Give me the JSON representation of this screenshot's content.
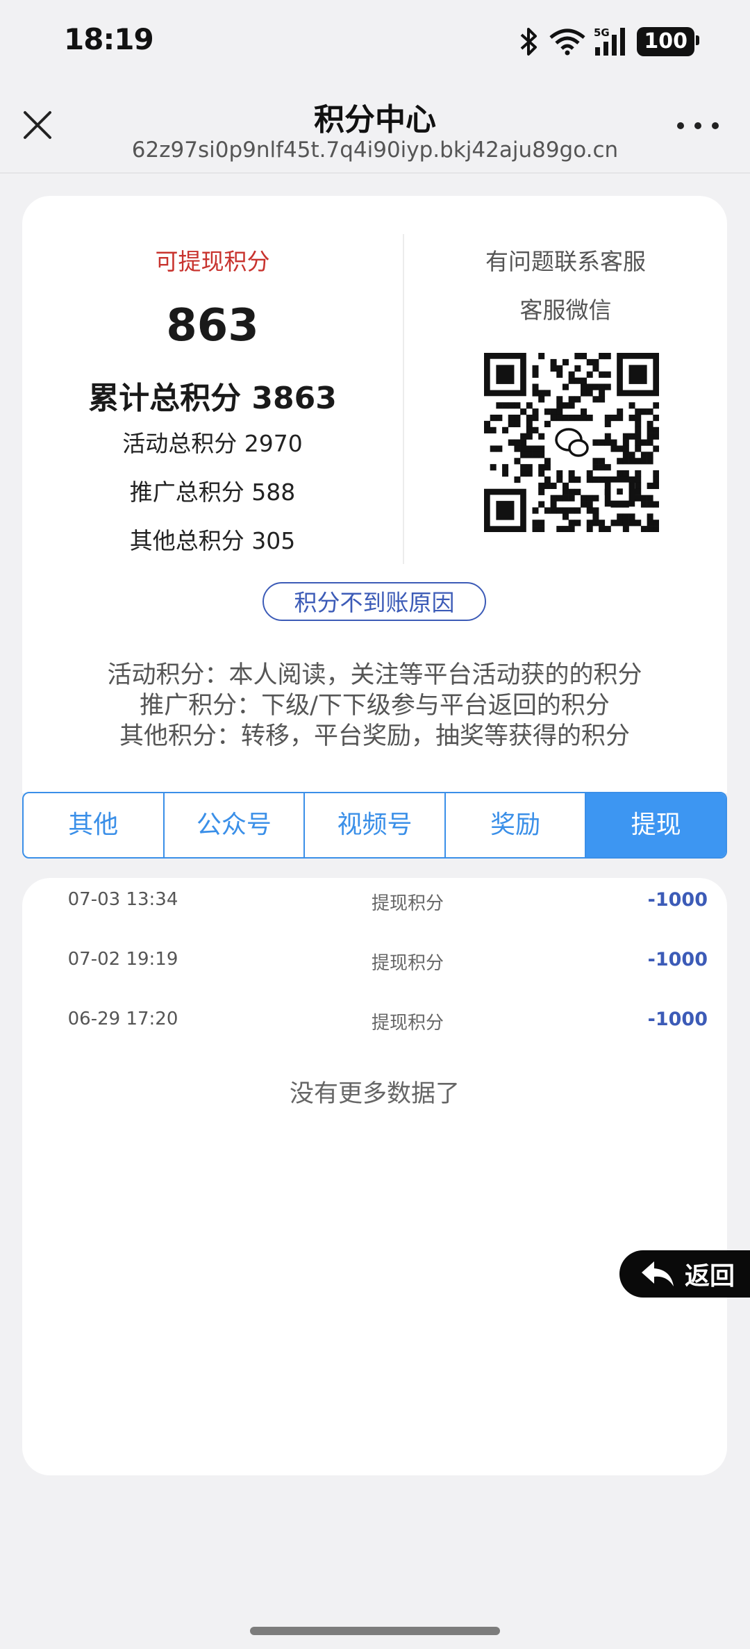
{
  "status_bar": {
    "time": "18:19",
    "network": "5G",
    "battery": "100"
  },
  "nav": {
    "title": "积分中心",
    "url": "62z97si0p9nlf45t.7q4i90iyp.bkj42aju89go.cn"
  },
  "points": {
    "withdrawable_label": "可提现积分",
    "withdrawable_value": "863",
    "total": "累计总积分 3863",
    "activity": "活动总积分 2970",
    "promotion": "推广总积分 588",
    "other": "其他总积分 305"
  },
  "service": {
    "line1": "有问题联系客服",
    "line2": "客服微信"
  },
  "reason_button": "积分不到账原因",
  "explanations": [
    "活动积分：本人阅读，关注等平台活动获的的积分",
    "推广积分：下级/下下级参与平台返回的积分",
    "其他积分：转移，平台奖励，抽奖等获得的积分"
  ],
  "tabs": [
    {
      "label": "其他",
      "active": false
    },
    {
      "label": "公众号",
      "active": false
    },
    {
      "label": "视频号",
      "active": false
    },
    {
      "label": "奖励",
      "active": false
    },
    {
      "label": "提现",
      "active": true
    }
  ],
  "records": [
    {
      "date": "07-03 13:34",
      "desc": "提现积分",
      "amount": "-1000"
    },
    {
      "date": "07-02 19:19",
      "desc": "提现积分",
      "amount": "-1000"
    },
    {
      "date": "06-29 17:20",
      "desc": "提现积分",
      "amount": "-1000"
    }
  ],
  "no_more": "没有更多数据了",
  "back_button": "返回",
  "colors": {
    "accent_blue": "#3d96f2",
    "red_label": "#c8332e",
    "amount_blue": "#3c5bb7"
  }
}
